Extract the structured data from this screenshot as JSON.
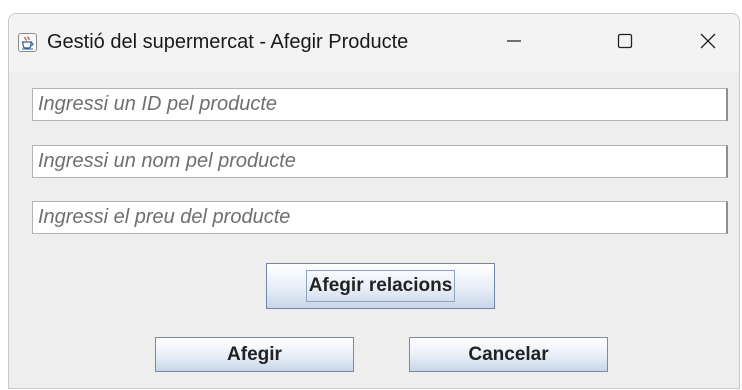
{
  "window": {
    "title": "Gestió del supermercat - Afegir Producte",
    "icons": {
      "app": "java-cup-icon",
      "minimize": "minimize-icon",
      "maximize": "maximize-icon",
      "close": "close-icon"
    }
  },
  "form": {
    "id_placeholder": "Ingressi un ID pel producte",
    "name_placeholder": "Ingressi un nom pel producte",
    "price_placeholder": "Ingressi el preu del producte",
    "id_value": "",
    "name_value": "",
    "price_value": ""
  },
  "buttons": {
    "relations_label": "Afegir relacions",
    "add_label": "Afegir",
    "cancel_label": "Cancelar"
  },
  "colors": {
    "window_bg": "#f0f0f0",
    "button_gradient_bottom": "#c8d6e8",
    "placeholder_text": "#666666"
  }
}
